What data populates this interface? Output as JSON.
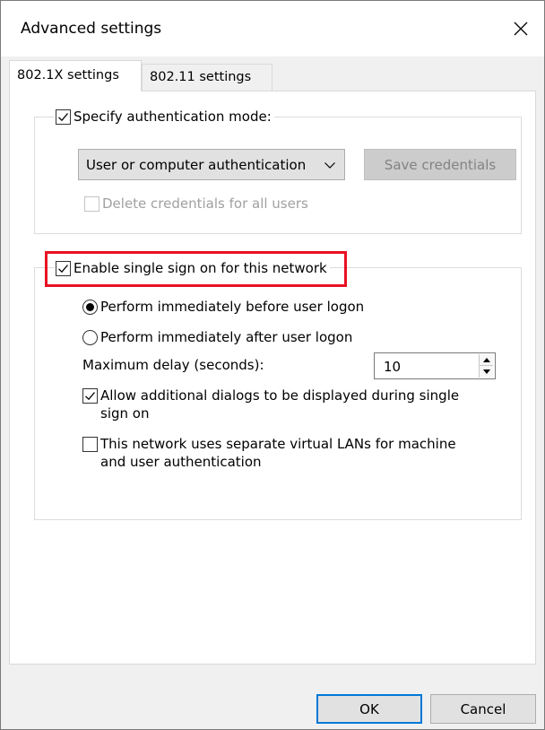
{
  "window": {
    "title": "Advanced settings"
  },
  "tabs": [
    {
      "label": "802.1X settings",
      "active": true
    },
    {
      "label": "802.11 settings",
      "active": false
    }
  ],
  "auth_group": {
    "specify_mode_label": "Specify authentication mode:",
    "specify_mode_checked": true,
    "mode_selected": "User or computer authentication",
    "save_credentials_label": "Save credentials",
    "delete_credentials_label": "Delete credentials for all users",
    "delete_credentials_checked": false
  },
  "sso_group": {
    "enable_label": "Enable single sign on for this network",
    "enable_checked": true,
    "perform_before_label": "Perform immediately before user logon",
    "perform_before_selected": true,
    "perform_after_label": "Perform immediately after user logon",
    "perform_after_selected": false,
    "max_delay_label": "Maximum delay (seconds):",
    "max_delay_value": "10",
    "allow_dialogs_label_line1": "Allow additional dialogs to be displayed during single",
    "allow_dialogs_label_line2": "sign on",
    "allow_dialogs_checked": true,
    "separate_vlans_label_line1": "This network uses separate virtual LANs for machine",
    "separate_vlans_label_line2": "and user authentication",
    "separate_vlans_checked": false
  },
  "footer": {
    "ok_label": "OK",
    "cancel_label": "Cancel"
  },
  "colors": {
    "highlight": "#e81123",
    "default_button_border": "#0078d7"
  },
  "icons": {
    "close": "close-icon",
    "check": "checkmark-icon",
    "dropdown": "chevron-down-icon",
    "spin_up": "spin-up-arrow-icon",
    "spin_down": "spin-down-arrow-icon"
  }
}
